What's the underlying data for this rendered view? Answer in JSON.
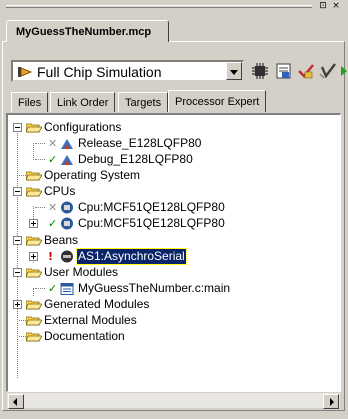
{
  "window": {
    "restore_glyph": "⊡",
    "close_glyph": "×"
  },
  "document_tab": {
    "title": "MyGuessTheNumber.mcp"
  },
  "target_selector": {
    "value": "Full Chip Simulation",
    "icon": "debug-plug-icon"
  },
  "toolbar": {
    "icons": [
      "chip-settings-icon",
      "make-icon",
      "check-icon",
      "debug-icon",
      "sync-icon"
    ]
  },
  "tabs": [
    {
      "label": "Files"
    },
    {
      "label": "Link Order"
    },
    {
      "label": "Targets"
    },
    {
      "label": "Processor Expert",
      "active": true
    }
  ],
  "tree": {
    "configurations": "Configurations",
    "release": "Release_E128LQFP80",
    "debug": "Debug_E128LQFP80",
    "os": "Operating System",
    "cpus": "CPUs",
    "cpu1": "Cpu:MCF51QE128LQFP80",
    "cpu2": "Cpu:MCF51QE128LQFP80",
    "beans": "Beans",
    "bean1": "AS1:AsynchroSerial",
    "user_modules": "User Modules",
    "main": "MyGuessTheNumber.c:main",
    "generated": "Generated Modules",
    "external": "External Modules",
    "documentation": "Documentation"
  },
  "colors": {
    "selection": "#0a246a",
    "folder": "#ffd65c",
    "check": "#008000",
    "warning": "#d00000"
  }
}
